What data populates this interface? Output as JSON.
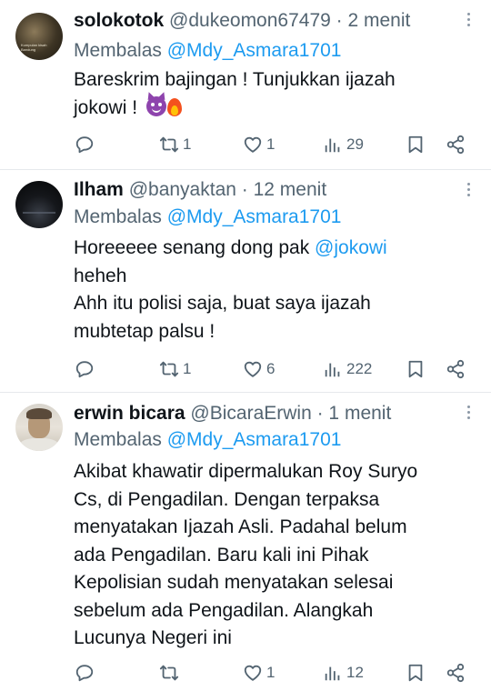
{
  "tweets": [
    {
      "name": "solokotok",
      "handle": "@dukeomon67479",
      "time": "· 2 menit",
      "reply_prefix": "Membalas",
      "reply_to": "@Mdy_Asmara1701",
      "avatar_text": "Kumpulan kisah Bandung",
      "lines": [
        "Bareskrim bajingan ! Tunjukkan ijazah",
        "jokowi ! "
      ],
      "emoji": [
        "smiling-devil-emoji",
        "fire-emoji"
      ],
      "retweets": "1",
      "likes": "1",
      "views": "29"
    },
    {
      "name": "Ilham",
      "handle": "@banyaktan",
      "time": "· 12 menit",
      "reply_prefix": "Membalas",
      "reply_to": "@Mdy_Asmara1701",
      "line1_text": "Horeeeee senang dong pak ",
      "line1_mention": "@jokowi",
      "lines": [
        "heheh",
        "Ahh itu polisi saja, buat saya ijazah",
        "mubtetap palsu !"
      ],
      "retweets": "1",
      "likes": "6",
      "views": "222"
    },
    {
      "name": "erwin bicara",
      "handle": "@BicaraErwin",
      "time": "· 1 menit",
      "reply_prefix": "Membalas",
      "reply_to": "@Mdy_Asmara1701",
      "lines": [
        "Akibat khawatir dipermalukan Roy Suryo",
        "Cs, di Pengadilan. Dengan terpaksa",
        "menyatakan Ijazah Asli. Padahal belum",
        "ada Pengadilan. Baru kali ini Pihak",
        "Kepolisian sudah menyatakan selesai",
        "sebelum ada Pengadilan. Alangkah",
        "Lucunya Negeri ini"
      ],
      "retweets": "",
      "likes": "1",
      "views": "12"
    }
  ],
  "icons": {
    "reply": "reply-icon",
    "retweet": "retweet-icon",
    "like": "heart-icon",
    "views": "views-icon",
    "bookmark": "bookmark-icon",
    "share": "share-icon",
    "more": "more-icon"
  },
  "colors": {
    "text": "#0f1419",
    "muted": "#536471",
    "link": "#1d9bf0",
    "divider": "#e6e9ec"
  }
}
